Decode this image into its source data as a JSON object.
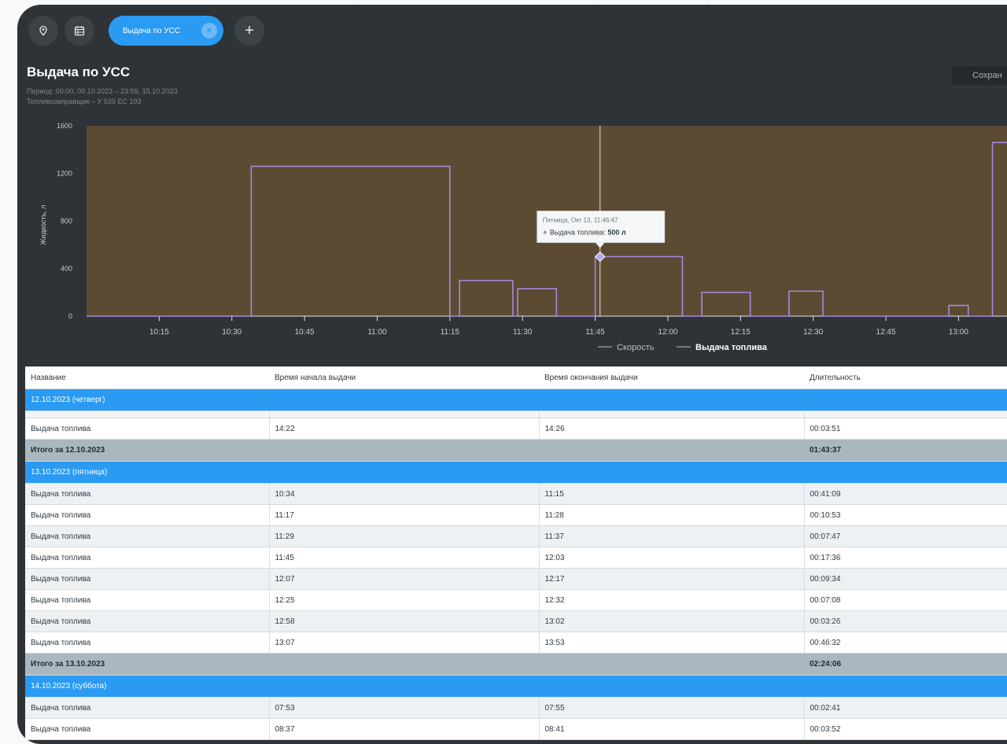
{
  "tabs": {
    "active_label": "Выдача по УСС",
    "close_symbol": "×",
    "add_symbol": "+"
  },
  "report": {
    "title": "Выдача по УСС",
    "period": "Период: 00:00, 09.10.2023 – 23:59, 15.10.2023",
    "vehicle": "Топливозаправщик – У 535 ЕС 193",
    "save_label": "Сохран"
  },
  "chart_data": {
    "type": "line",
    "ylabel": "Жидкость, л",
    "ylim": [
      0,
      1600
    ],
    "y_ticks": [
      0,
      400,
      800,
      1200,
      1600
    ],
    "x_ticks": [
      "10:15",
      "10:30",
      "10:45",
      "11:00",
      "11:15",
      "11:30",
      "11:45",
      "12:00",
      "12:15",
      "12:30",
      "12:45",
      "13:00"
    ],
    "xlim_minutes": [
      600,
      790
    ],
    "series": [
      {
        "name": "Выдача топлива",
        "steps": [
          {
            "start": "10:34",
            "end": "11:15",
            "value": 1260
          },
          {
            "start": "11:17",
            "end": "11:28",
            "value": 300
          },
          {
            "start": "11:29",
            "end": "11:37",
            "value": 230
          },
          {
            "start": "11:45",
            "end": "12:03",
            "value": 500
          },
          {
            "start": "12:07",
            "end": "12:17",
            "value": 200
          },
          {
            "start": "12:25",
            "end": "12:32",
            "value": 210
          },
          {
            "start": "12:58",
            "end": "13:02",
            "value": 90
          },
          {
            "start": "13:07",
            "end": "13:53",
            "value": 1460
          }
        ]
      }
    ],
    "legend": [
      "Скорость",
      "Выдача топлива"
    ],
    "legend_active": "Выдача топлива",
    "tooltip": {
      "time_label": "Пятница, Окт 13, 11:46:47",
      "series_label": "Выдача топлива",
      "value_label": "500 л",
      "x": "11:46",
      "y": 500
    }
  },
  "table": {
    "headers": [
      "Название",
      "Время начала выдачи",
      "Время окончания выдачи",
      "Длительность"
    ],
    "groups": [
      {
        "day": "12.10.2023 (четверг)",
        "rows": [
          [
            "Выдача топлива",
            "14:22",
            "14:26",
            "00:03:51"
          ]
        ],
        "total_label": "Итого за 12.10.2023",
        "total_value": "01:43:37"
      },
      {
        "day": "13.10.2023 (пятница)",
        "rows": [
          [
            "Выдача топлива",
            "10:34",
            "11:15",
            "00:41:09"
          ],
          [
            "Выдача топлива",
            "11:17",
            "11:28",
            "00:10:53"
          ],
          [
            "Выдача топлива",
            "11:29",
            "11:37",
            "00:07:47"
          ],
          [
            "Выдача топлива",
            "11:45",
            "12:03",
            "00:17:36"
          ],
          [
            "Выдача топлива",
            "12:07",
            "12:17",
            "00:09:34"
          ],
          [
            "Выдача топлива",
            "12:25",
            "12:32",
            "00:07:08"
          ],
          [
            "Выдача топлива",
            "12:58",
            "13:02",
            "00:03:26"
          ],
          [
            "Выдача топлива",
            "13:07",
            "13:53",
            "00:46:32"
          ]
        ],
        "total_label": "Итого за 13.10.2023",
        "total_value": "02:24:06"
      },
      {
        "day": "14.10.2023 (суббота)",
        "rows": [
          [
            "Выдача топлива",
            "07:53",
            "07:55",
            "00:02:41"
          ],
          [
            "Выдача топлива",
            "08:37",
            "08:41",
            "00:03:52"
          ]
        ]
      }
    ]
  },
  "colors": {
    "plot_bg": "#5c4b33",
    "series_line": "#a48ae0",
    "accent": "#2b9af3",
    "panel_bg": "#2e3337",
    "total_row": "#a9b8bf"
  }
}
